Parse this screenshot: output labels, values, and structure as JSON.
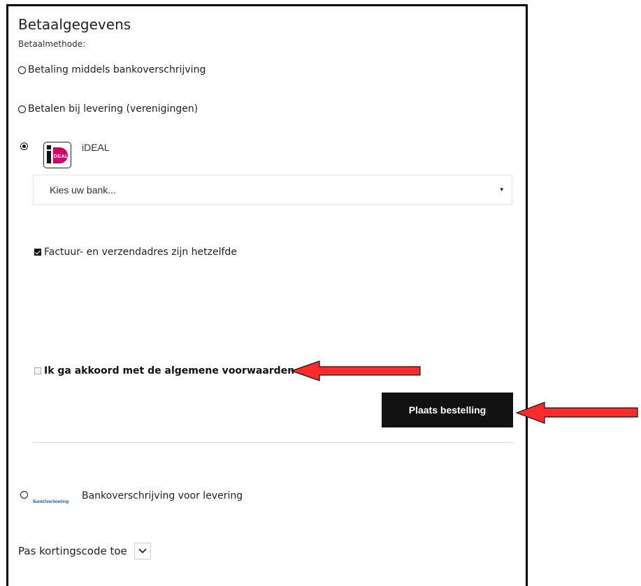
{
  "payment": {
    "heading": "Betaalgegevens",
    "method_label": "Betaalmethode:",
    "options": [
      {
        "label": "Betaling middels bankoverschrijving",
        "selected": false
      },
      {
        "label": "Betalen bij levering (verenigingen)",
        "selected": false
      },
      {
        "label": "iDEAL",
        "selected": true
      },
      {
        "label": "Bankoverschrijving voor levering",
        "selected": false
      }
    ],
    "ideal_logo_text": "iDEAL",
    "bank_logo_text_1": "Bank",
    "bank_logo_text_2": "Overboeking",
    "bank_select": {
      "value": "Kies uw bank...",
      "caret": "▾"
    }
  },
  "address": {
    "same_label": "Factuur- en verzendadres zijn hetzelfde",
    "checked": true
  },
  "terms": {
    "label": "Ik ga akkoord met de algemene voorwaarden",
    "checked": false
  },
  "order": {
    "button_label": "Plaats bestelling"
  },
  "discount": {
    "label": "Pas kortingscode toe",
    "toggle_icon": "chevron-down-icon"
  },
  "colors": {
    "arrow": "#ff2a2a",
    "button_bg": "#111111",
    "ideal_pink": "#cc0066"
  }
}
